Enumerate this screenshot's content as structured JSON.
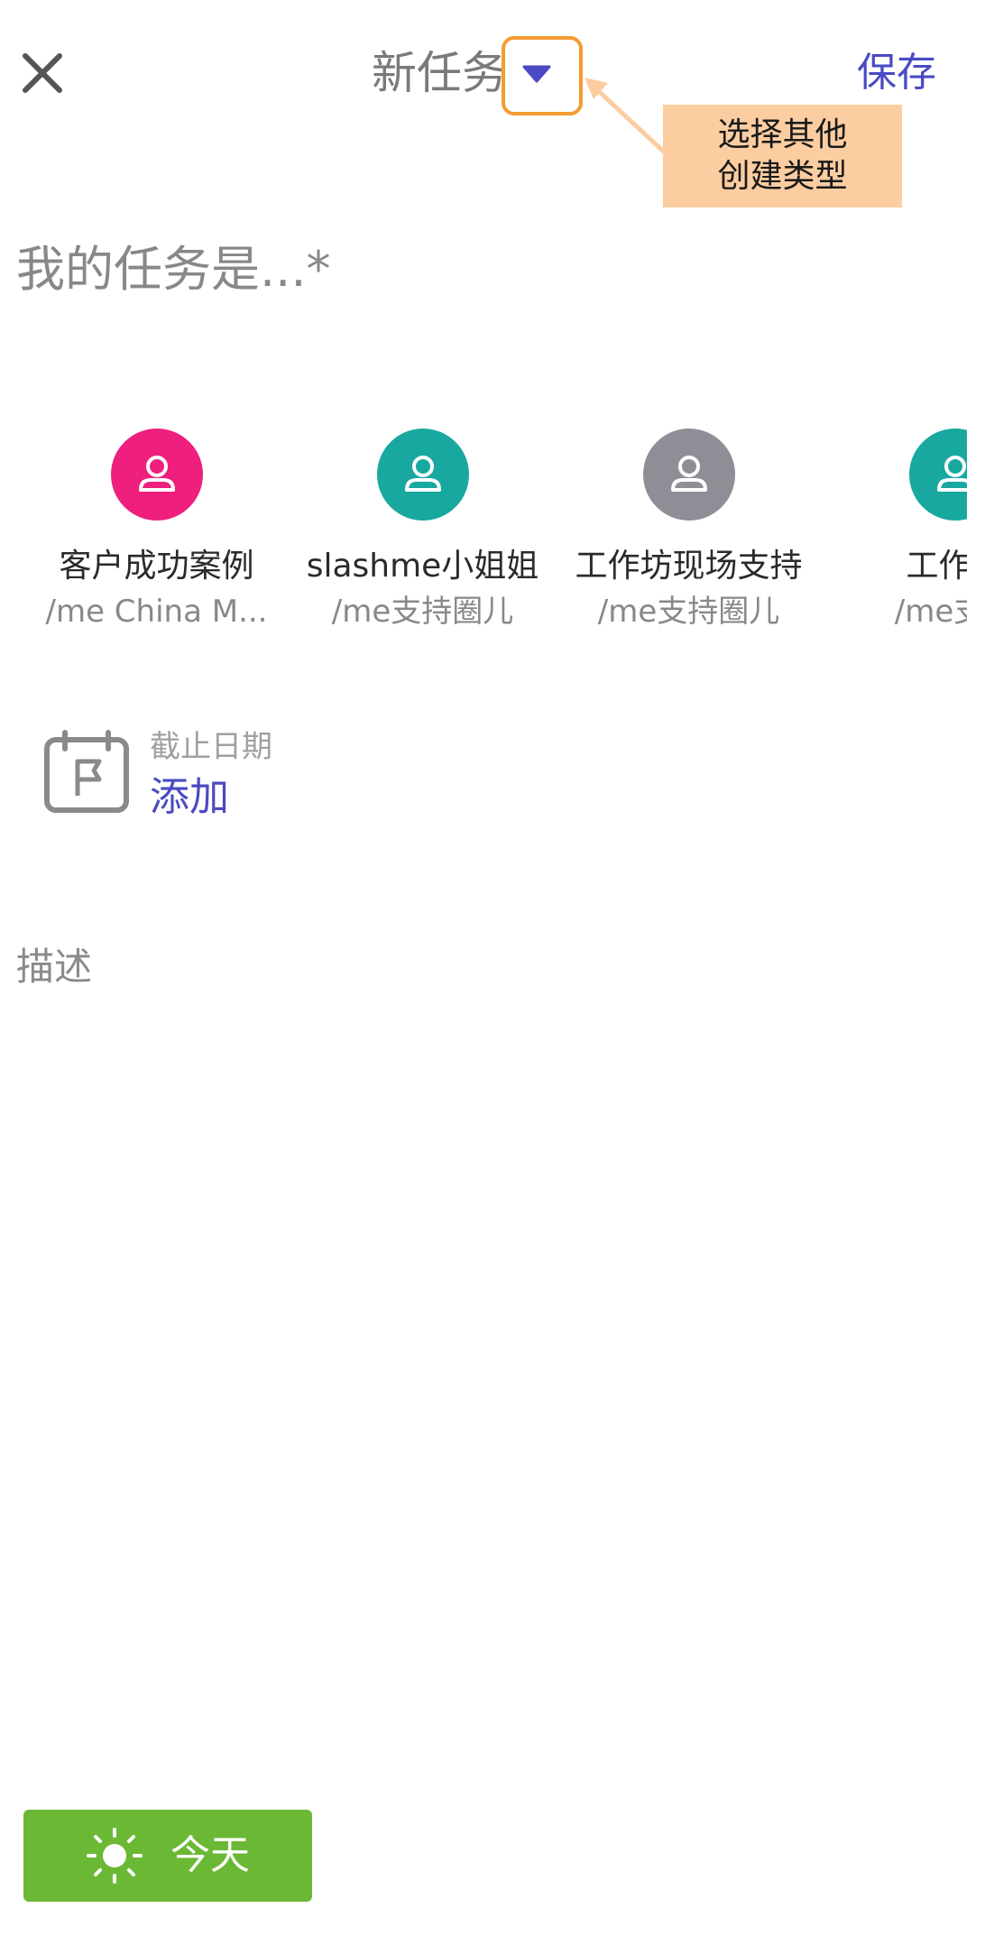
{
  "header": {
    "title": "新任务",
    "save_label": "保存"
  },
  "callout": {
    "line1": "选择其他",
    "line2": "创建类型"
  },
  "task_input": {
    "placeholder": "我的任务是...*",
    "value": ""
  },
  "circles": [
    {
      "name": "客户成功案例",
      "subtitle": "/me China M...",
      "color": "#ee1f7d"
    },
    {
      "name": "slashme小姐姐",
      "subtitle": "/me支持圈儿",
      "color": "#18a8a0"
    },
    {
      "name": "工作坊现场支持",
      "subtitle": "/me支持圈儿",
      "color": "#8e8e96"
    },
    {
      "name": "工作坊",
      "subtitle": "/me支持",
      "color": "#18a8a0"
    }
  ],
  "due_date": {
    "label": "截止日期",
    "action": "添加"
  },
  "description": {
    "placeholder": "描述",
    "value": ""
  },
  "today_button": {
    "label": "今天"
  },
  "colors": {
    "accent": "#4a4ac4",
    "highlight": "#f39c32",
    "callout_bg": "#fbcda1",
    "today_green": "#6bb835"
  },
  "icons": {
    "close": "close-icon",
    "dropdown": "caret-down-icon",
    "avatar": "person-icon",
    "calendar": "calendar-flag-icon",
    "sun": "sun-icon"
  }
}
